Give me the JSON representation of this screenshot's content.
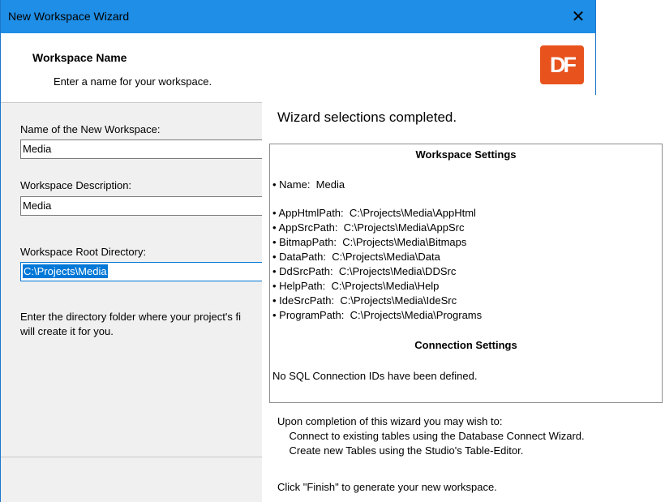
{
  "window": {
    "title": "New Workspace Wizard",
    "close_label": "✕"
  },
  "header": {
    "title": "Workspace Name",
    "subtitle": "Enter a name for your workspace.",
    "logo_text": "DF",
    "logo_color": "#e8531d"
  },
  "form": {
    "name_label": "Name of the New Workspace:",
    "name_value": "Media",
    "description_label": "Workspace Description:",
    "description_value": "Media",
    "root_label": "Workspace Root Directory:",
    "root_value": "C:\\Projects\\Media",
    "hint": "Enter the directory folder where your project's fi\nwill create it for you."
  },
  "summary": {
    "heading": "Wizard selections completed.",
    "workspace_settings_title": "Workspace Settings",
    "name_line": "• Name:  Media",
    "paths": [
      "• AppHtmlPath:  C:\\Projects\\Media\\AppHtml",
      "• AppSrcPath:  C:\\Projects\\Media\\AppSrc",
      "• BitmapPath:  C:\\Projects\\Media\\Bitmaps",
      "• DataPath:  C:\\Projects\\Media\\Data",
      "• DdSrcPath:  C:\\Projects\\Media\\DDSrc",
      "• HelpPath:  C:\\Projects\\Media\\Help",
      "• IdeSrcPath:  C:\\Projects\\Media\\IdeSrc",
      "• ProgramPath:  C:\\Projects\\Media\\Programs"
    ],
    "connection_settings_title": "Connection Settings",
    "connection_text": "No SQL Connection IDs have been defined.",
    "completion_intro": "Upon completion of this wizard you may wish to:",
    "completion_item_1": "    Connect to existing tables using the Database Connect Wizard.",
    "completion_item_2": "    Create new Tables using the Studio's Table-Editor.",
    "finish_text": "Click \"Finish\" to generate your new workspace."
  },
  "colors": {
    "titlebar": "#1f8ee6",
    "selection": "#0078d7"
  }
}
